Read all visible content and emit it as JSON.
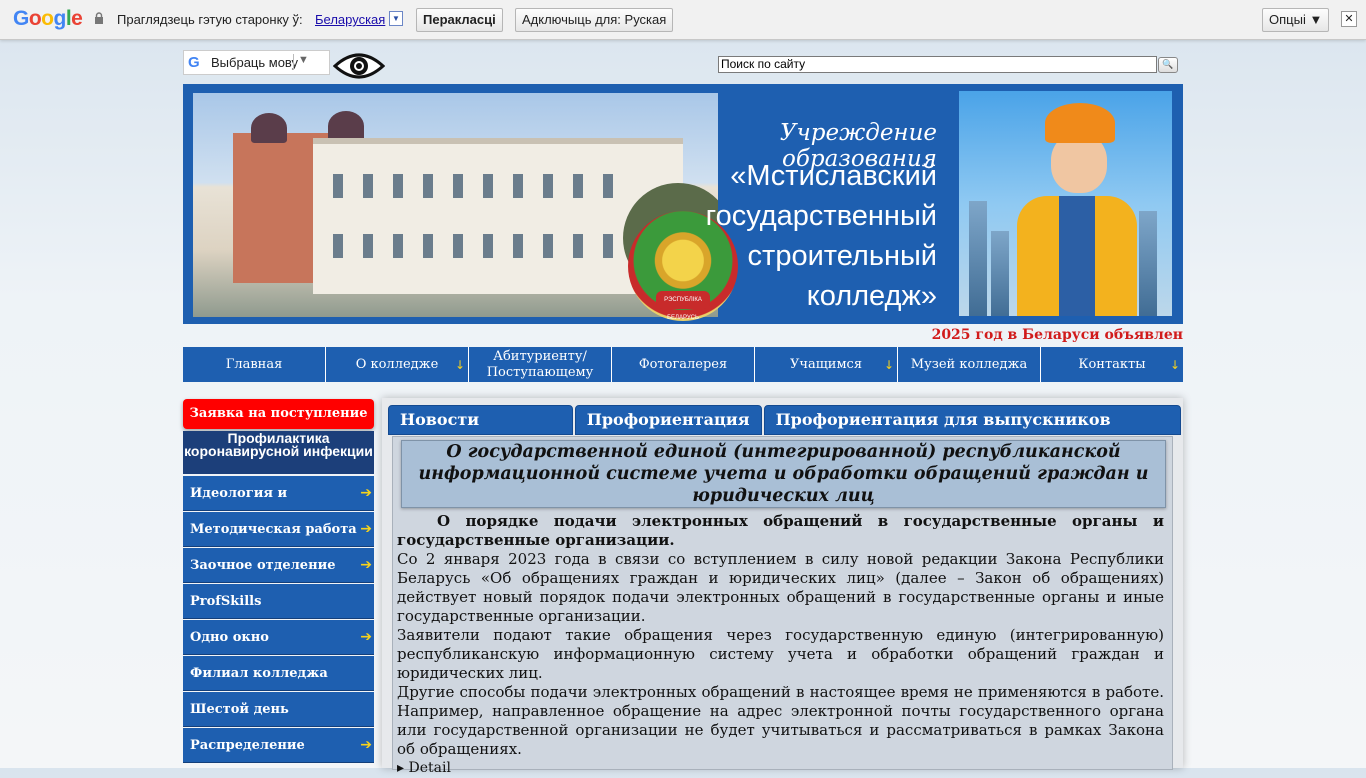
{
  "translate_bar": {
    "logo": "Google",
    "prompt": "Праглядзець гэтую старонку ў:",
    "language": "Беларуская",
    "translate_button": "Перакласці",
    "disable_button": "Адключыць для: Руская",
    "options_button": "Опцыі ▼",
    "close": "✕"
  },
  "header": {
    "language_selector": "Выбраць мову",
    "search_value": "Поиск по сайту",
    "search_button": "🔍"
  },
  "banner": {
    "line1": "Учреждение образования",
    "line2": "«Мстиславский",
    "line3": "государственный",
    "line4": "строительный",
    "line5": "колледж»",
    "emblem_text": "РЭСПУБЛІКА БЕЛАРУСЬ"
  },
  "year_notice": "2025 год в Беларуси объявлен",
  "nav": {
    "items": [
      {
        "label": "Главная",
        "arrow": ""
      },
      {
        "label": "О колледже",
        "arrow": "↓"
      },
      {
        "label": "Абитуриенту/ Поступающему",
        "arrow": ""
      },
      {
        "label": "Фотогалерея",
        "arrow": ""
      },
      {
        "label": "Учащимся",
        "arrow": "↓"
      },
      {
        "label": "Музей колледжа",
        "arrow": ""
      },
      {
        "label": "Контакты",
        "arrow": "↓"
      }
    ]
  },
  "sidebar": {
    "apply_button": "Заявка на поступление",
    "covid_banner": "Профилактика коронавирусной инфекции",
    "items": [
      {
        "label": "Идеология и воспитание",
        "arrow": "➔"
      },
      {
        "label": "Методическая работа",
        "arrow": "➔"
      },
      {
        "label": "Заочное отделение",
        "arrow": "➔"
      },
      {
        "label": "ProfSkills",
        "arrow": ""
      },
      {
        "label": "Одно окно",
        "arrow": "➔"
      },
      {
        "label": "Филиал колледжа",
        "arrow": ""
      },
      {
        "label": "Шестой день",
        "arrow": ""
      },
      {
        "label": "Распределение",
        "arrow": "➔"
      }
    ]
  },
  "tabs": [
    "Новости колледжа",
    "Профориентация",
    "Профориентация для выпускников колледжа"
  ],
  "article": {
    "title": "О государственной единой (интегрированной) республиканской информационной системе учета и обработки обращений граждан и юридических лиц",
    "lead": "О порядке подачи электронных обращений в государственные органы и государственные организации.",
    "p1": "Со 2 января 2023 года в связи со вступлением в силу новой редакции Закона Республики Беларусь «Об обращениях граждан и юридических лиц» (далее – Закон об обращениях) действует новый порядок подачи электронных обращений в государственные органы и иные государственные организации.",
    "p2": "Заявители подают такие обращения через государственную единую (интегрированную) республиканскую информационную систему учета и обработки обращений граждан и юридических лиц.",
    "p3": "Другие способы подачи электронных обращений в настоящее время не применяются в работе. Например, направленное обращение на адрес электронной почты государственного органа или государственной организации не будет учитываться и рассматриваться в рамках Закона об обращениях.",
    "details": "▸ Detail"
  },
  "colors": {
    "brand_blue": "#1e5fb0",
    "accent_red": "#ff0000",
    "arrow_yellow": "#f5d21d",
    "year_red": "#d11b1b"
  },
  "icons": [
    "lock-icon",
    "google-g-icon",
    "eye-icon",
    "search-icon",
    "close-icon",
    "arrow-down-icon",
    "arrow-right-icon"
  ]
}
